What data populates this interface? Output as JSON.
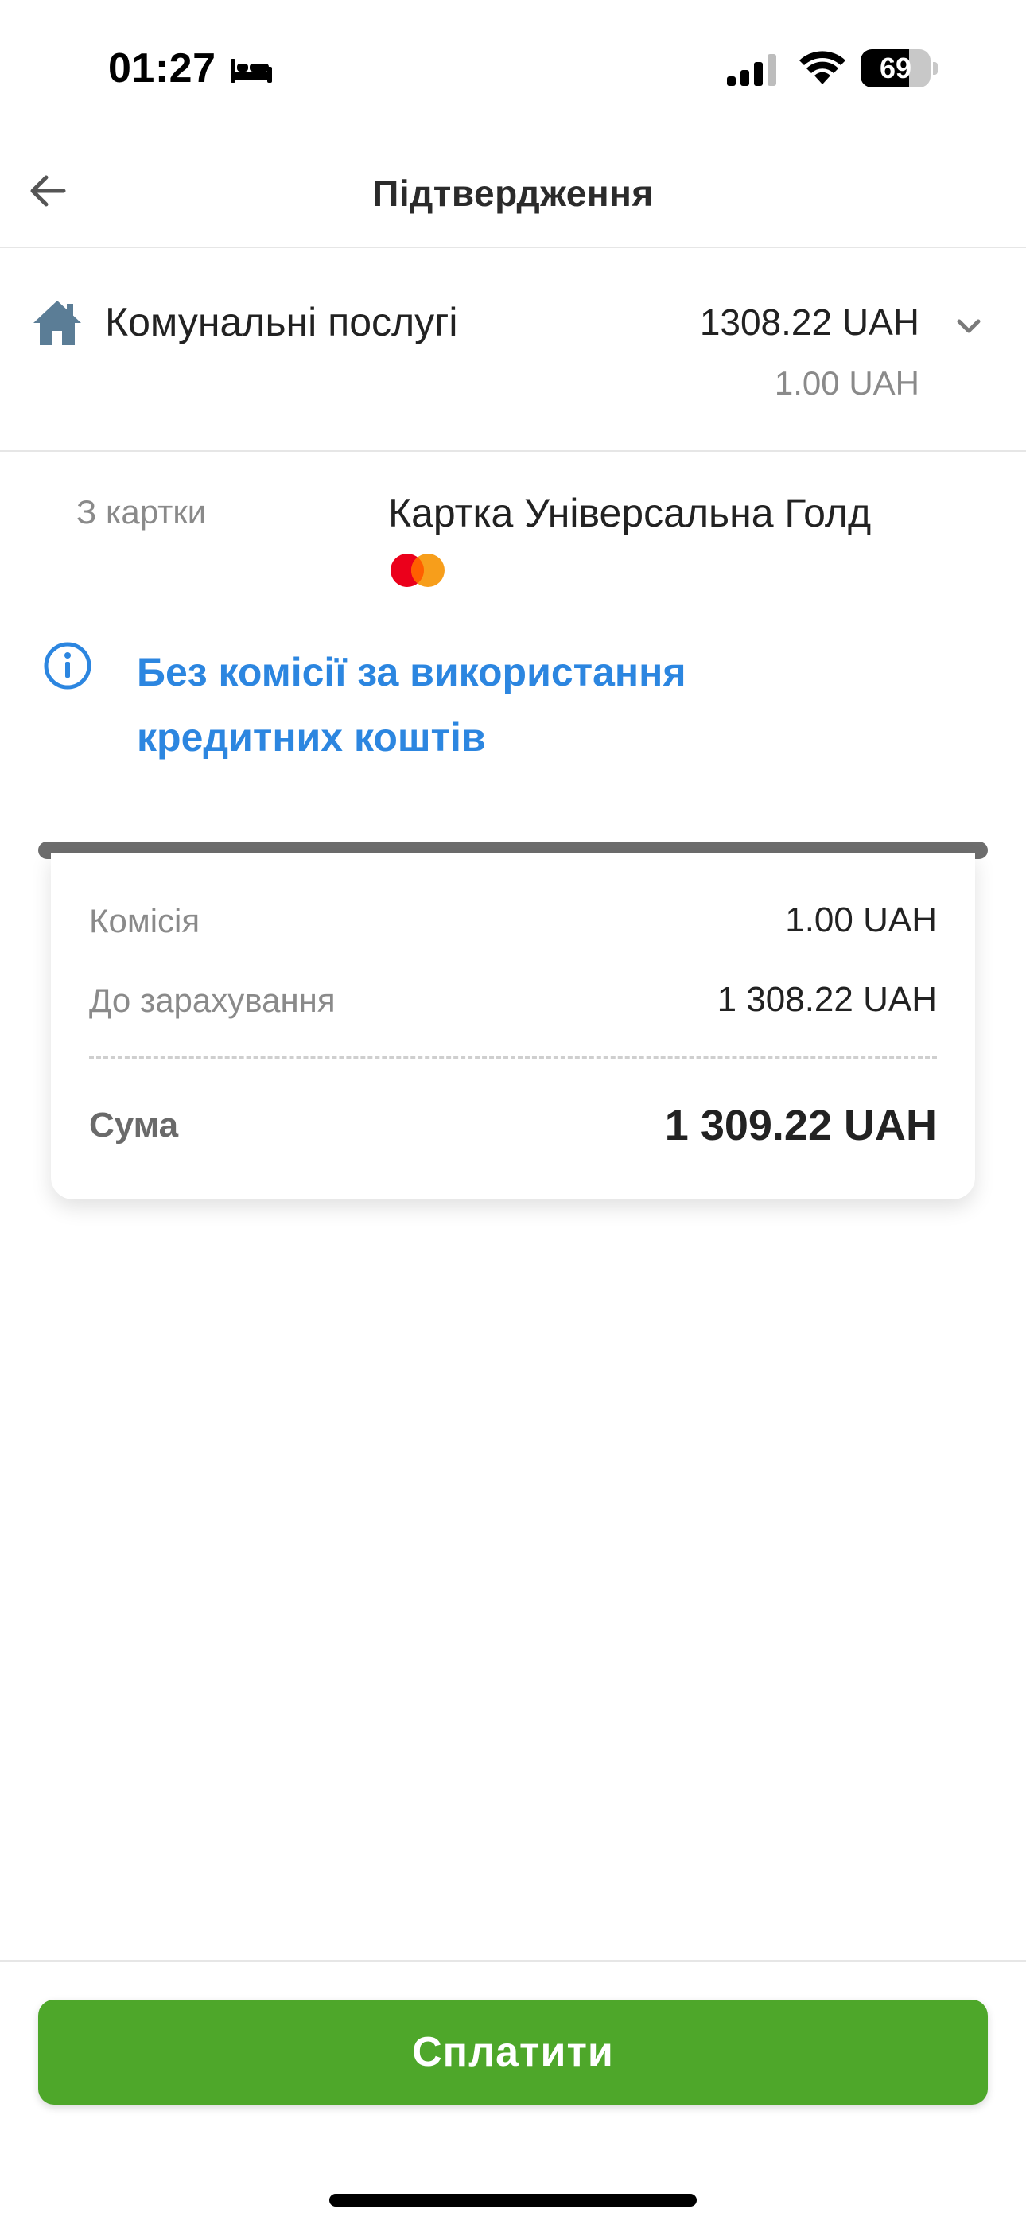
{
  "status_bar": {
    "time": "01:27",
    "battery_level": "69",
    "battery_fraction": 0.69,
    "icons": [
      "bed-icon",
      "signal-icon",
      "wifi-icon",
      "battery-icon"
    ]
  },
  "header": {
    "title": "Підтвердження",
    "back_icon": "arrow-left-icon"
  },
  "payment": {
    "icon": "house-icon",
    "name": "Комунальні послугі",
    "amount": "1308.22 UAH",
    "fee": "1.00 UAH",
    "expand_icon": "chevron-down-icon"
  },
  "source": {
    "label": "З картки",
    "card_name": "Картка Універсальна Голд",
    "card_icon": "mastercard-icon"
  },
  "info": {
    "icon": "info-icon",
    "line1": "Без комісії за використання",
    "line2": "кредитних коштів"
  },
  "receipt": {
    "commission_label": "Комісія",
    "commission_value": "1.00 UAH",
    "credited_label": "До зарахування",
    "credited_value": "1 308.22 UAH",
    "total_label": "Сума",
    "total_value": "1 309.22 UAH"
  },
  "footer": {
    "pay_label": "Сплатити"
  },
  "colors": {
    "accent_blue": "#2c86e0",
    "pay_green": "#4ea72a",
    "house_icon": "#5b7d96",
    "mastercard_red": "#eb001b",
    "mastercard_orange": "#f79e1b"
  }
}
